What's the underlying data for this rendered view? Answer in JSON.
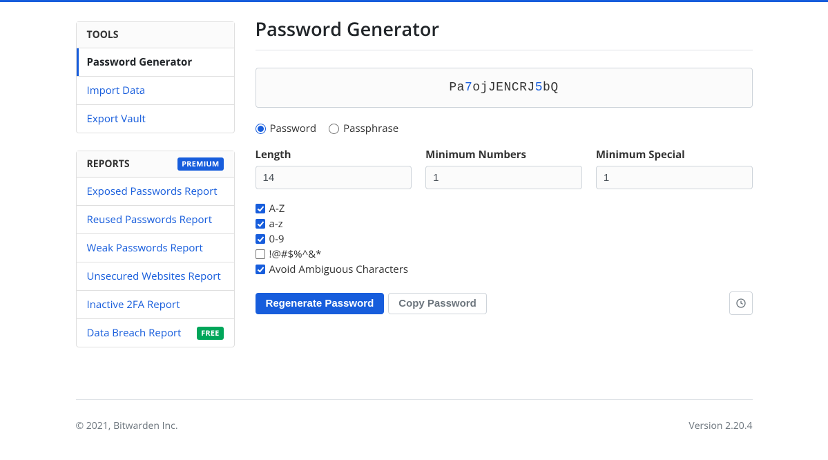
{
  "sidebar": {
    "tools_header": "Tools",
    "tools_items": [
      {
        "label": "Password Generator",
        "active": true
      },
      {
        "label": "Import Data",
        "active": false
      },
      {
        "label": "Export Vault",
        "active": false
      }
    ],
    "reports_header": "Reports",
    "reports_badge": "Premium",
    "reports_items": [
      {
        "label": "Exposed Passwords Report",
        "badge": null
      },
      {
        "label": "Reused Passwords Report",
        "badge": null
      },
      {
        "label": "Weak Passwords Report",
        "badge": null
      },
      {
        "label": "Unsecured Websites Report",
        "badge": null
      },
      {
        "label": "Inactive 2FA Report",
        "badge": null
      },
      {
        "label": "Data Breach Report",
        "badge": "Free"
      }
    ]
  },
  "page": {
    "title": "Password Generator",
    "password_segments": [
      {
        "t": "l",
        "v": "Pa"
      },
      {
        "t": "n",
        "v": "7"
      },
      {
        "t": "l",
        "v": "ojJENCRJ"
      },
      {
        "t": "n",
        "v": "5"
      },
      {
        "t": "l",
        "v": "bQ"
      }
    ],
    "type": {
      "password_label": "Password",
      "passphrase_label": "Passphrase",
      "selected": "password"
    },
    "fields": {
      "length_label": "Length",
      "length_value": "14",
      "min_numbers_label": "Minimum Numbers",
      "min_numbers_value": "1",
      "min_special_label": "Minimum Special",
      "min_special_value": "1"
    },
    "options": {
      "upper_label": "A-Z",
      "upper_checked": true,
      "lower_label": "a-z",
      "lower_checked": true,
      "numbers_label": "0-9",
      "numbers_checked": true,
      "special_label": "!@#$%^&*",
      "special_checked": false,
      "ambiguous_label": "Avoid Ambiguous Characters",
      "ambiguous_checked": true
    },
    "buttons": {
      "regenerate": "Regenerate Password",
      "copy": "Copy Password"
    }
  },
  "footer": {
    "copyright": "© 2021, Bitwarden Inc.",
    "version": "Version 2.20.4"
  }
}
